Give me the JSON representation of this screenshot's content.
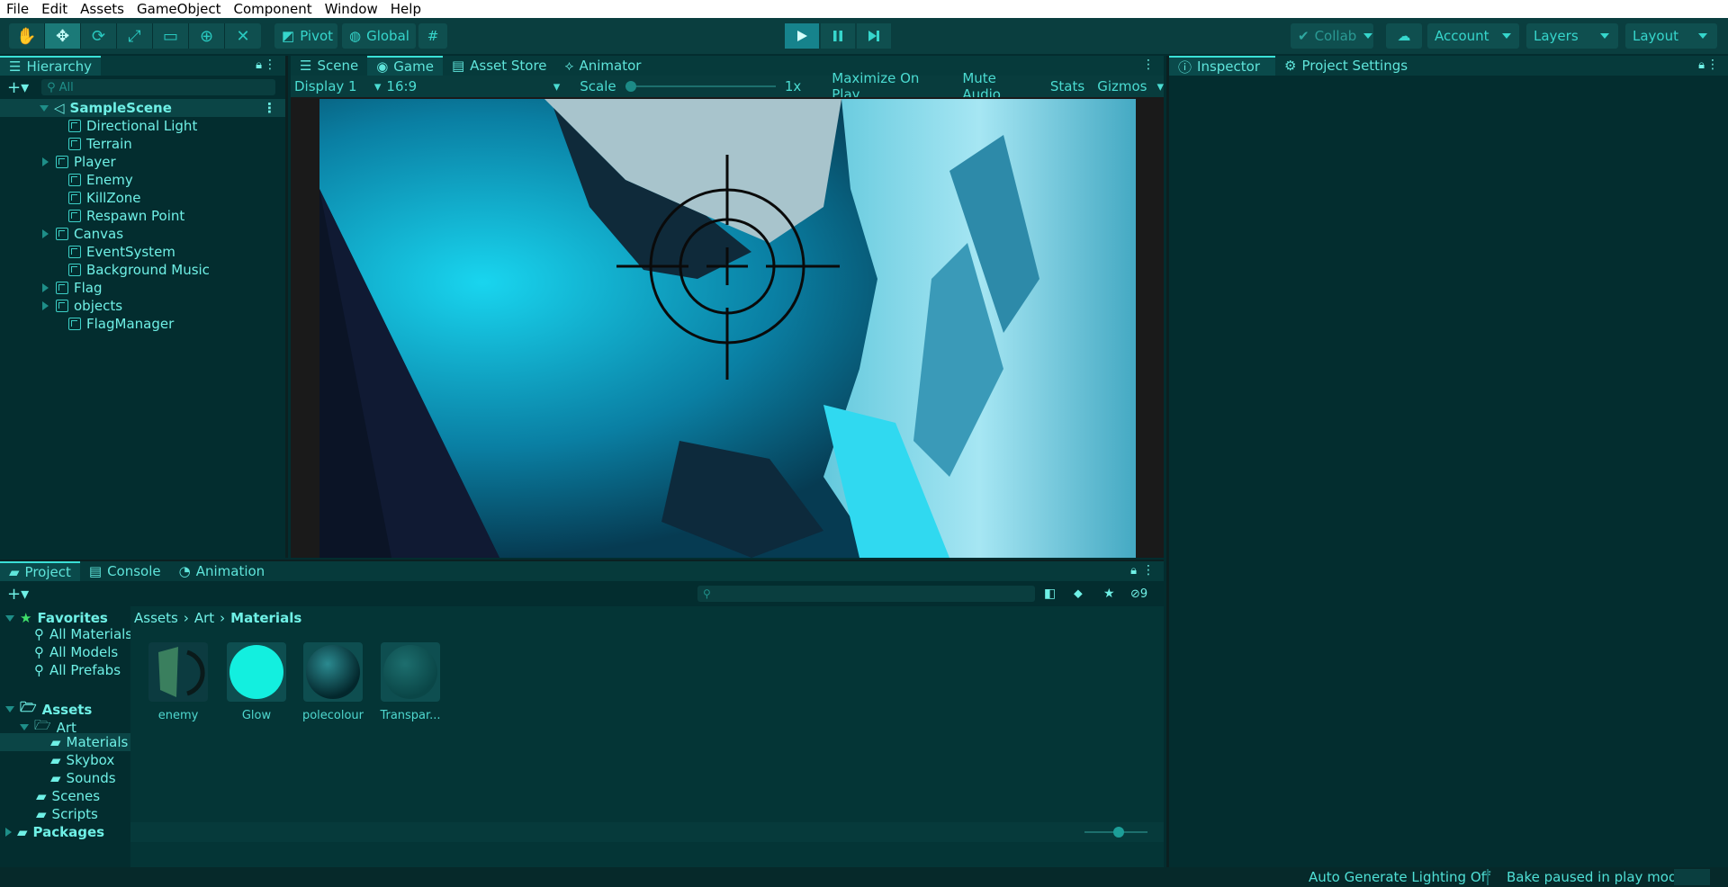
{
  "menu": [
    "File",
    "Edit",
    "Assets",
    "GameObject",
    "Component",
    "Window",
    "Help"
  ],
  "toolbar": {
    "pivot_label": "Pivot",
    "global_label": "Global",
    "collab_label": "Collab",
    "account_label": "Account",
    "layers_label": "Layers",
    "layout_label": "Layout"
  },
  "hierarchy": {
    "title": "Hierarchy",
    "search_placeholder": "All",
    "scene_name": "SampleScene",
    "items": [
      {
        "label": "Directional Light",
        "expandable": false
      },
      {
        "label": "Terrain",
        "expandable": false
      },
      {
        "label": "Player",
        "expandable": true
      },
      {
        "label": "Enemy",
        "expandable": false
      },
      {
        "label": "KillZone",
        "expandable": false
      },
      {
        "label": "Respawn Point",
        "expandable": false
      },
      {
        "label": "Canvas",
        "expandable": true
      },
      {
        "label": "EventSystem",
        "expandable": false
      },
      {
        "label": "Background Music",
        "expandable": false
      },
      {
        "label": "Flag",
        "expandable": true
      },
      {
        "label": "objects",
        "expandable": true
      },
      {
        "label": "FlagManager",
        "expandable": false
      }
    ]
  },
  "center_tabs": [
    "Scene",
    "Game",
    "Asset Store",
    "Animator"
  ],
  "active_center_tab": "Game",
  "gamebar": {
    "display": "Display 1",
    "aspect": "16:9",
    "scale_label": "Scale",
    "scale_value": "1x",
    "maximize": "Maximize On Play",
    "mute": "Mute Audio",
    "stats": "Stats",
    "gizmos": "Gizmos"
  },
  "project": {
    "tabs": [
      "Project",
      "Console",
      "Animation"
    ],
    "hidden_count": "9",
    "favorites_label": "Favorites",
    "favorites": [
      "All Materials",
      "All Models",
      "All Prefabs"
    ],
    "assets_label": "Assets",
    "tree": {
      "art": "Art",
      "materials": "Materials",
      "skybox": "Skybox",
      "sounds": "Sounds",
      "scenes": "Scenes",
      "scripts": "Scripts",
      "packages": "Packages"
    },
    "breadcrumb": [
      "Assets",
      "Art",
      "Materials"
    ],
    "assets": [
      "enemy",
      "Glow",
      "polecolour",
      "Transpar..."
    ]
  },
  "inspector": {
    "tabs": [
      "Inspector",
      "Project Settings"
    ]
  },
  "status": {
    "lighting": "Auto Generate Lighting Off",
    "bake": "Bake paused in play mode"
  },
  "colors": {
    "accent": "#3ae0d6",
    "panel": "#032d2f",
    "toolbar": "#0a3e3f",
    "play_active": "#16838c"
  }
}
